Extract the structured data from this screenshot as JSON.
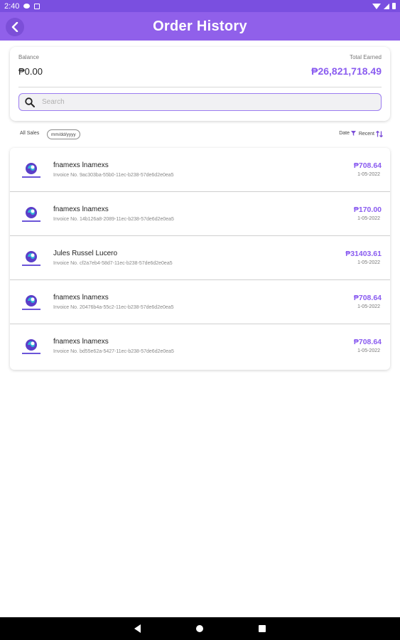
{
  "status_bar": {
    "time": "2:40"
  },
  "header": {
    "title": "Order History"
  },
  "summary": {
    "balance_label": "Balance",
    "balance_value": "₱0.00",
    "earned_label": "Total Earned",
    "earned_value": "₱26,821,718.49",
    "search_placeholder": "Search"
  },
  "filters": {
    "all_sales": "All Sales",
    "date_placeholder": "mm/dd/yyyy",
    "date_label": "Date",
    "recent_label": "Recent"
  },
  "orders": [
    {
      "name": "fnamexs lnamexs",
      "invoice": "Invoice No. 9ac303ba-55b0-11ec-b238-57de6d2e0ea5",
      "amount": "₱708.64",
      "date": "1-05-2022"
    },
    {
      "name": "fnamexs lnamexs",
      "invoice": "Invoice No. 14b126a8-2089-11ec-b238-57de6d2e0ea5",
      "amount": "₱170.00",
      "date": "1-05-2022"
    },
    {
      "name": "Jules Russel Lucero",
      "invoice": "Invoice No. cf2a7eb4-58d7-11ec-b238-57de6d2e0ea5",
      "amount": "₱31403.61",
      "date": "1-05-2022"
    },
    {
      "name": "fnamexs lnamexs",
      "invoice": "Invoice No. 20476b4a-55c2-11ec-b238-57de6d2e0ea5",
      "amount": "₱708.64",
      "date": "1-05-2022"
    },
    {
      "name": "fnamexs lnamexs",
      "invoice": "Invoice No. bd55e62a-5427-11ec-b238-57de6d2e0ea5",
      "amount": "₱708.64",
      "date": "1-05-2022"
    }
  ],
  "colors": {
    "primary": "#9060ea",
    "accent": "#8a5cf0",
    "status_bar": "#7a4fe0"
  },
  "icons": [
    "back-arrow-icon",
    "search-icon",
    "filter-icon",
    "sort-icon",
    "store-logo"
  ]
}
